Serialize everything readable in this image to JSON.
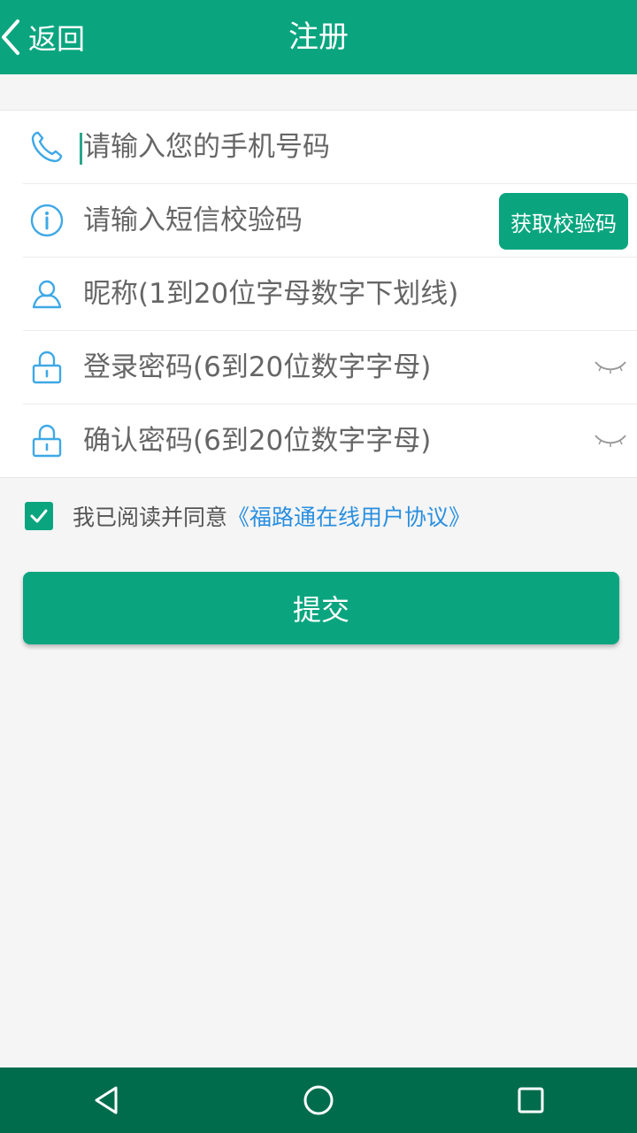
{
  "header": {
    "back_label": "返回",
    "title": "注册"
  },
  "form": {
    "phone": {
      "placeholder": "请输入您的手机号码",
      "value": "",
      "icon": "phone-icon"
    },
    "sms_code": {
      "placeholder": "请输入短信校验码",
      "value": "",
      "icon": "info-icon",
      "button_label": "获取校验码"
    },
    "nickname": {
      "placeholder": "昵称(1到20位字母数字下划线)",
      "value": "",
      "icon": "user-icon"
    },
    "password": {
      "placeholder": "登录密码(6到20位数字字母)",
      "value": "",
      "icon": "lock-icon"
    },
    "confirm_password": {
      "placeholder": "确认密码(6到20位数字字母)",
      "value": "",
      "icon": "lock-icon"
    }
  },
  "agreement": {
    "checked": true,
    "text": "我已阅读并同意",
    "link": "《福路通在线用户协议》"
  },
  "submit_label": "提交",
  "colors": {
    "primary": "#0aa57f",
    "nav_bar": "#006c4c",
    "link": "#2a8fe0",
    "icon": "#3fa8e6"
  }
}
